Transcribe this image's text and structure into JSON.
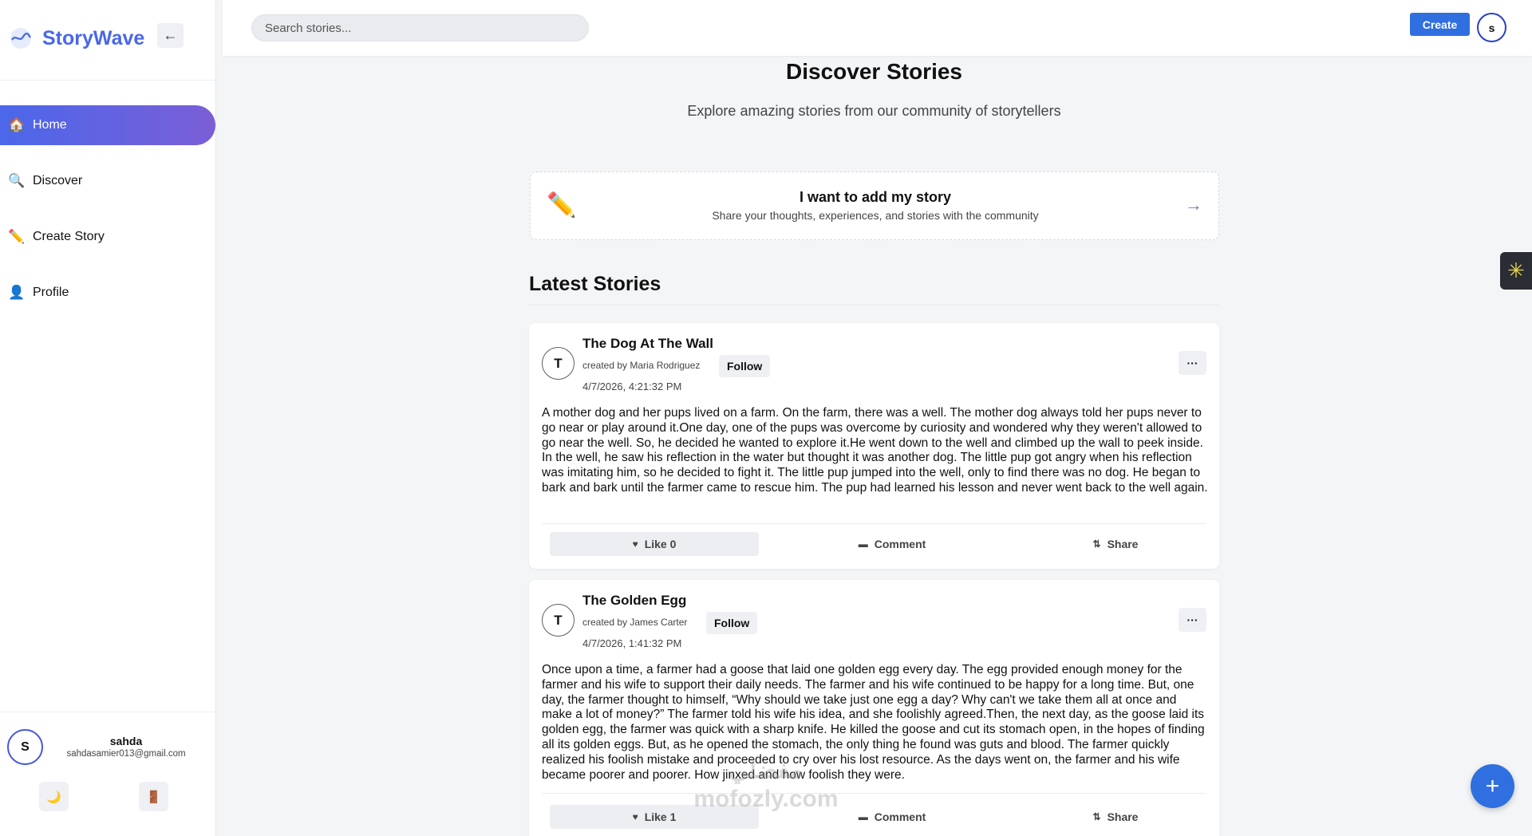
{
  "app": {
    "name": "StoryWave",
    "collapse_glyph": "←"
  },
  "sidebar": {
    "items": [
      {
        "label": "Home",
        "icon": "🏠",
        "icon_name": "home-icon",
        "active": true
      },
      {
        "label": "Discover",
        "icon": "🔍",
        "icon_name": "search-icon",
        "active": false
      },
      {
        "label": "Create Story",
        "icon": "✏️",
        "icon_name": "pencil-icon",
        "active": false
      },
      {
        "label": "Profile",
        "icon": "👤",
        "icon_name": "user-icon",
        "active": false
      }
    ],
    "user": {
      "initial": "S",
      "name": "sahda",
      "email": "sahdasamier013@gmail.com"
    },
    "theme_icon": "🌙",
    "logout_icon": "🚪"
  },
  "topbar": {
    "search_placeholder": "Search stories...",
    "create_label": "Create",
    "avatar_initial": "s"
  },
  "main": {
    "title": "Discover Stories",
    "subtitle": "Explore amazing stories from our community of storytellers",
    "add_story": {
      "icon": "✏️",
      "title": "I want to add my story",
      "subtitle": "Share your thoughts, experiences, and stories with the community",
      "arrow": "→"
    },
    "latest_heading": "Latest Stories",
    "stories": [
      {
        "initial": "T",
        "title": "The Dog At The Wall",
        "created_by": "created by Maria Rodriguez",
        "follow": "Follow",
        "date": "4/7/2026, 4:21:32 PM",
        "more": "···",
        "body": "A mother dog and her pups lived on a farm. On the farm, there was a well. The mother dog always told her pups never to go near or play around it.One day, one of the pups was overcome by curiosity and wondered why they weren't allowed to go near the well. So, he decided he wanted to explore it.He went down to the well and climbed up the wall to peek inside. In the well, he saw his reflection in the water but thought it was another dog. The little pup got angry when his reflection was imitating him, so he decided to fight it. The little pup jumped into the well, only to find there was no dog. He began to bark and bark until the farmer came to rescue him. The pup had learned his lesson and never went back to the well again.",
        "like": "Like 0",
        "comment": "Comment",
        "share": "Share"
      },
      {
        "initial": "T",
        "title": "The Golden Egg",
        "created_by": "created by James Carter",
        "follow": "Follow",
        "date": "4/7/2026, 1:41:32 PM",
        "more": "···",
        "body": "Once upon a time, a farmer had a goose that laid one golden egg every day. The egg provided enough money for the farmer and his wife to support their daily needs. The farmer and his wife continued to be happy for a long time. But, one day, the farmer thought to himself, “Why should we take just one egg a day? Why can't we take them all at once and make a lot of money?” The farmer told his wife his idea, and she foolishly agreed.Then, the next day, as the goose laid its golden egg, the farmer was quick with a sharp knife. He killed the goose and cut its stomach open, in the hopes of finding all its golden eggs. But, as he opened the stomach, the only thing he found was guts and blood. The farmer quickly realized his foolish mistake and proceeded to cry over his lost resource. As the days went on, the farmer and his wife became poorer and poorer. How jinxed and how foolish they were.",
        "like": "Like 1",
        "comment": "Comment",
        "share": "Share"
      }
    ]
  },
  "floating": {
    "fab": "+",
    "side_tab_icon": "✳"
  },
  "watermark": {
    "line1": "مفضلي",
    "line2": "mofozly.com"
  },
  "colors": {
    "accent": "#2f6fe0",
    "brand": "#4a67e8",
    "nav_gradient_start": "#4b67ea",
    "nav_gradient_end": "#7b5ed6"
  }
}
